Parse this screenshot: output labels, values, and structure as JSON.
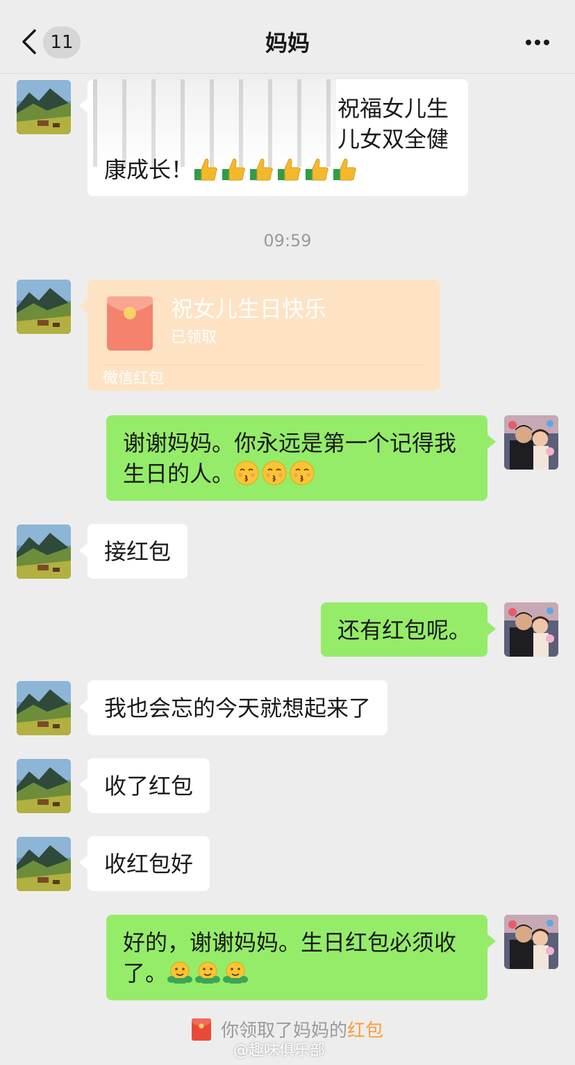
{
  "header": {
    "back_count": "11",
    "title": "妈妈"
  },
  "messages": {
    "m1": {
      "line1": "祝福女儿生",
      "line2": "儿女双全健",
      "line3": "康成长！"
    },
    "time": "09:59",
    "redpacket": {
      "title": "祝女儿生日快乐",
      "status": "已领取",
      "footer": "微信红包"
    },
    "m2": {
      "line1": "谢谢妈妈。你永远是第一个记得我",
      "line2": "生日的人。"
    },
    "m3": "接红包",
    "m4": "还有红包呢。",
    "m5": "我也会忘的今天就想起来了",
    "m6": "收了红包",
    "m7": "收红包好",
    "m8": {
      "line1": "好的，谢谢妈妈。生日红包必须收",
      "line2": "了。"
    }
  },
  "system": {
    "prefix": "你领取了妈妈的",
    "highlight": "红包"
  },
  "watermark": "@趣味俱乐部",
  "colors": {
    "background": "#ededed",
    "bubble_self": "#95ec69",
    "bubble_other": "#ffffff",
    "redpacket_bg": "#fde3c4",
    "highlight": "#fa9d3b"
  }
}
